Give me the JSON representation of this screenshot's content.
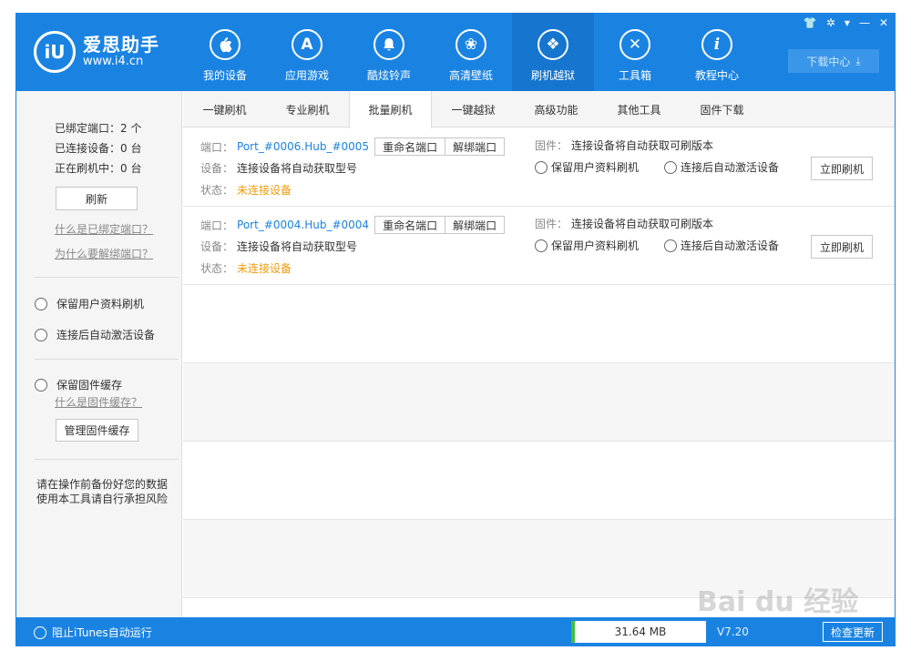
{
  "header": {
    "logo_icon": "iU",
    "logo_name": "爱思助手",
    "logo_url": "www.i4.cn",
    "nav": [
      {
        "label": "我的设备",
        "icon": "apple-icon",
        "glyph": ""
      },
      {
        "label": "应用游戏",
        "icon": "app-store-icon",
        "glyph": "A"
      },
      {
        "label": "酷炫铃声",
        "icon": "bell-icon",
        "glyph": "🔔"
      },
      {
        "label": "高清壁纸",
        "icon": "flower-icon",
        "glyph": "❀"
      },
      {
        "label": "刷机越狱",
        "icon": "dropbox-icon",
        "glyph": "❖"
      },
      {
        "label": "工具箱",
        "icon": "tools-icon",
        "glyph": "✕"
      },
      {
        "label": "教程中心",
        "icon": "info-icon",
        "glyph": "i"
      }
    ],
    "active_nav": "刷机越狱",
    "download_center": "下载中心",
    "window_controls": [
      "👕",
      "✲",
      "▾",
      "—",
      "✕"
    ]
  },
  "sidebar": {
    "bound_ports": "已绑定端口：2 个",
    "connected_devices": "已连接设备：0 台",
    "flashing": "正在刷机中：0 台",
    "refresh_label": "刷新",
    "link_bound": "什么是已绑定端口？",
    "link_unbind": "为什么要解绑端口？",
    "opt_keep_data": "保留用户资料刷机",
    "opt_auto_activate": "连接后自动激活设备",
    "opt_keep_fw_cache": "保留固件缓存",
    "link_fw_cache": "什么是固件缓存？",
    "manage_fw_cache": "管理固件缓存",
    "warning_line1": "请在操作前备份好您的数据",
    "warning_line2": "使用本工具请自行承担风险"
  },
  "tabs": [
    "一键刷机",
    "专业刷机",
    "批量刷机",
    "一键越狱",
    "高级功能",
    "其他工具",
    "固件下载"
  ],
  "active_tab": "批量刷机",
  "ports": [
    {
      "port_label": "端口：",
      "port_value": "Port_#0006.Hub_#0005",
      "rename_label": "重命名端口",
      "unbind_label": "解绑端口",
      "device_label": "设备：",
      "device_value": "连接设备将自动获取型号",
      "status_label": "状态：",
      "status_value": "未连接设备",
      "fw_label": "固件：",
      "fw_value": "连接设备将自动获取可刷版本",
      "opt_keep_data": "保留用户资料刷机",
      "opt_auto_activate": "连接后自动激活设备",
      "flash_label": "立即刷机"
    },
    {
      "port_label": "端口：",
      "port_value": "Port_#0004.Hub_#0004",
      "rename_label": "重命名端口",
      "unbind_label": "解绑端口",
      "device_label": "设备：",
      "device_value": "连接设备将自动获取型号",
      "status_label": "状态：",
      "status_value": "未连接设备",
      "fw_label": "固件：",
      "fw_value": "连接设备将自动获取可刷版本",
      "opt_keep_data": "保留用户资料刷机",
      "opt_auto_activate": "连接后自动激活设备",
      "flash_label": "立即刷机"
    }
  ],
  "statusbar": {
    "itunes_label": "阻止iTunes自动运行",
    "memory": "31.64 MB",
    "version": "V7.20",
    "check_update": "检查更新"
  },
  "watermark": "Bai du 经验",
  "colors": {
    "primary": "#1a83e2",
    "status_warning": "#f29b0a",
    "link_blue": "#1a83e2"
  }
}
